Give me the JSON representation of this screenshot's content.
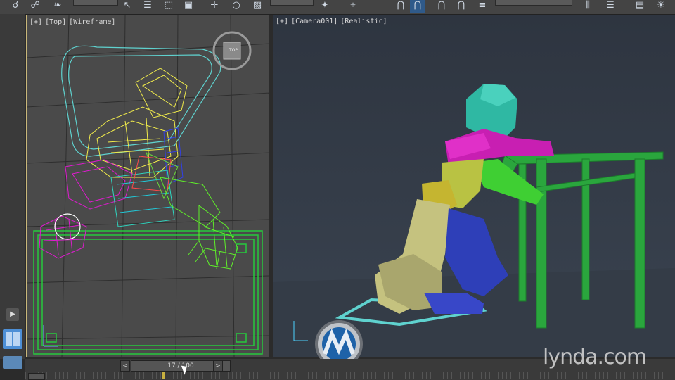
{
  "toolbar": {
    "icons": [
      "link-icon",
      "unlink-icon",
      "bind-icon",
      "select-icon",
      "select-name-icon",
      "region-icon",
      "window-crossing-icon",
      "move-icon",
      "rotate-icon",
      "scale-icon",
      "pivot-icon",
      "snap-icon",
      "angle-snap-icon",
      "percent-snap-icon",
      "spinner-snap-icon",
      "edit-named-sets-icon",
      "mirror-icon",
      "align-icon",
      "layer-icon",
      "ribbon-icon"
    ]
  },
  "viewports": {
    "left": {
      "plus": "[+]",
      "view": "[Top]",
      "shading": "[Wireframe]",
      "gizmo_label": "TOP"
    },
    "right": {
      "plus": "[+]",
      "view": "[Camera001]",
      "shading": "[Realistic]"
    }
  },
  "timeline": {
    "frame_label": "17 / 100",
    "current_frame": 17,
    "total_frames": 100,
    "prev": "<",
    "next": ">"
  },
  "watermark": {
    "text": "lynda.com"
  },
  "colors": {
    "viewport_bg_left": "#4a4a4a",
    "viewport_bg_right": "#36404c",
    "active_border": "#c9b77a",
    "skin_cyan": "#5fd2cf",
    "skin_magenta": "#d020c8",
    "skin_yellow": "#f1ec4b",
    "skin_olive": "#c5c27f",
    "skin_blue": "#3240c2",
    "table_green": "#2aa63d"
  }
}
